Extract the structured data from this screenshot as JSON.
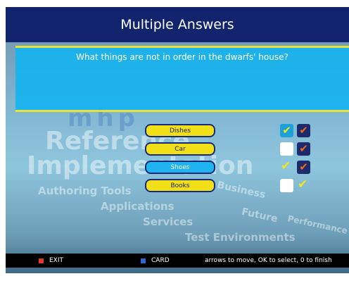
{
  "title": "Multiple Answers",
  "question": "What things are not in order in the dwarfs' house?",
  "answers": [
    {
      "label": "Dishes",
      "selected": false,
      "user_checked": true,
      "key_checked": true
    },
    {
      "label": "Car",
      "selected": false,
      "user_checked": false,
      "key_checked": true
    },
    {
      "label": "Shoes",
      "selected": true,
      "user_checked": true,
      "key_checked": true
    },
    {
      "label": "Books",
      "selected": false,
      "user_checked": false,
      "key_checked": true
    }
  ],
  "background_text": {
    "logo": "mhp",
    "line1": "Reference",
    "line2": "Implementation",
    "item1": "Authoring Tools",
    "item2": "Applications",
    "item3": "Services",
    "item4": "Test Environments",
    "tag1": "Business",
    "tag2": "Future",
    "tag3": "Performance"
  },
  "footer": {
    "exit_label": "EXIT",
    "card_label": "CARD",
    "hint": "arrows to move, OK to select, 0 to finish"
  },
  "colors": {
    "title_bg": "#12246e",
    "panel_bg": "#14b4f0",
    "accent_yellow": "#e8e23a",
    "button_yellow": "#f1e017",
    "button_selected": "#1fb4ef",
    "check_orange": "#f06a10"
  }
}
